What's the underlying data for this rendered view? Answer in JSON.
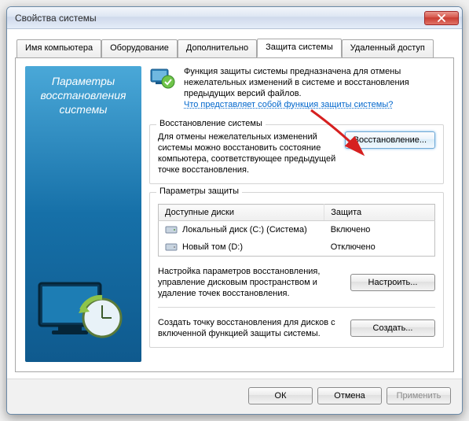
{
  "window": {
    "title": "Свойства системы"
  },
  "tabs": {
    "computer_name": "Имя компьютера",
    "hardware": "Оборудование",
    "advanced": "Дополнительно",
    "protection": "Защита системы",
    "remote": "Удаленный доступ"
  },
  "sidebar": {
    "line1": "Параметры",
    "line2": "восстановления",
    "line3": "системы"
  },
  "intro": {
    "text": "Функция защиты системы предназначена для отмены нежелательных изменений в системе и восстановления предыдущих версий файлов.",
    "link": "Что представляет собой функция защиты системы?"
  },
  "restore": {
    "legend": "Восстановление системы",
    "text": "Для отмены нежелательных изменений системы можно восстановить состояние компьютера, соответствующее предыдущей точке восстановления.",
    "button": "Восстановление..."
  },
  "protection": {
    "legend": "Параметры защиты",
    "table": {
      "col1": "Доступные диски",
      "col2": "Защита",
      "rows": [
        {
          "name": "Локальный диск (C:) (Система)",
          "status": "Включено"
        },
        {
          "name": "Новый том (D:)",
          "status": "Отключено"
        }
      ]
    },
    "configure_text": "Настройка параметров восстановления, управление дисковым пространством и удаление точек восстановления.",
    "configure_btn": "Настроить...",
    "create_text": "Создать точку восстановления для дисков с включенной функцией защиты системы.",
    "create_btn": "Создать..."
  },
  "footer": {
    "ok": "ОК",
    "cancel": "Отмена",
    "apply": "Применить"
  }
}
